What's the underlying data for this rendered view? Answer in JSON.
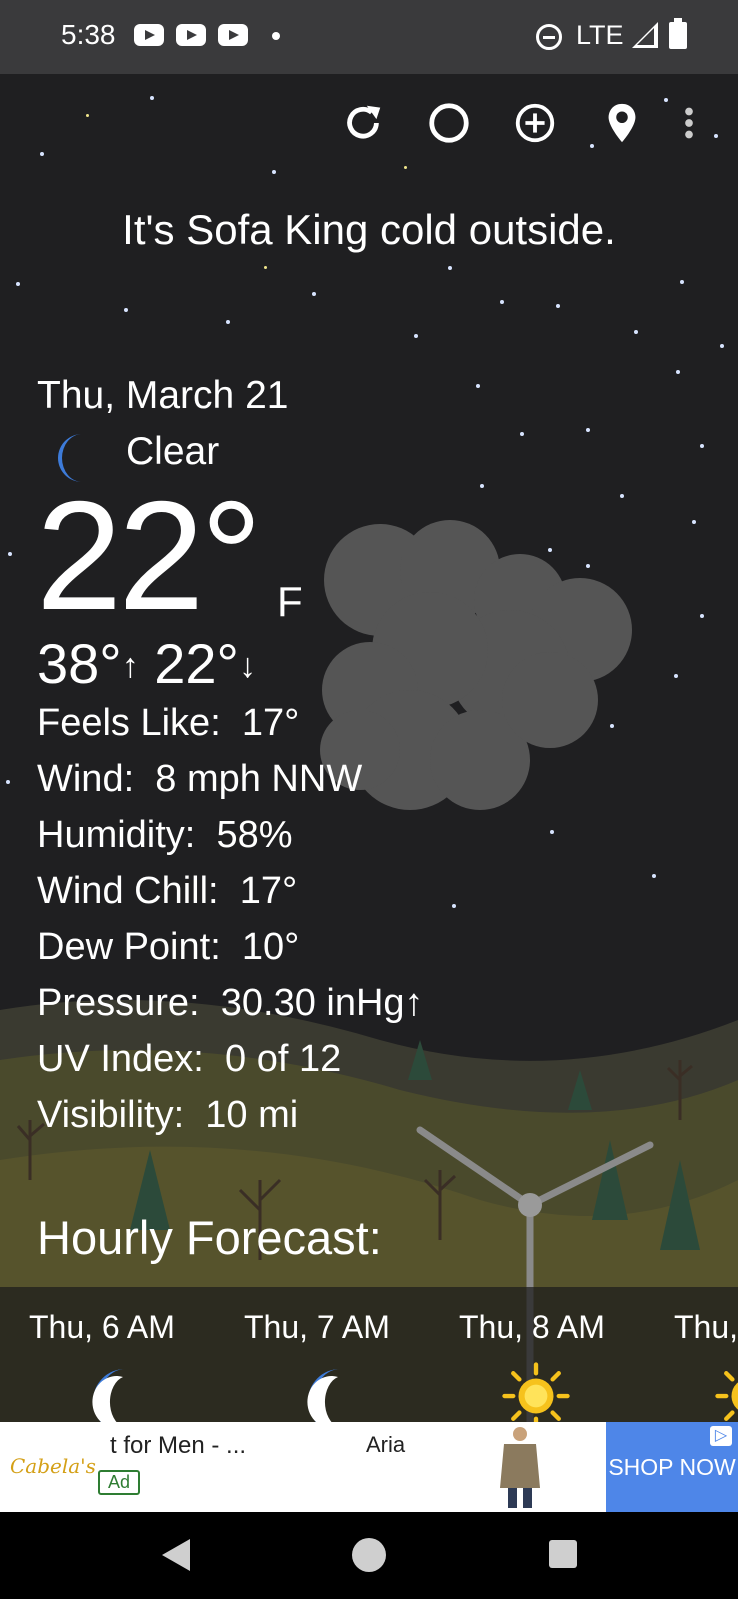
{
  "status_bar": {
    "time": "5:38",
    "network": "LTE"
  },
  "toolbar": {
    "refresh_icon": "refresh-icon",
    "theme_icon": "moon-phase-icon",
    "add_icon": "add-location-icon",
    "location_icon": "location-pin-icon",
    "menu_icon": "overflow-menu-icon"
  },
  "tagline": "It's Sofa King cold outside.",
  "current": {
    "date": "Thu, March 21",
    "condition": "Clear",
    "condition_icon": "moon-icon",
    "temperature": "22°",
    "unit": "F",
    "high": "38°",
    "low": "22°"
  },
  "details": [
    {
      "label": "Feels Like:",
      "value": "17°"
    },
    {
      "label": "Wind:",
      "value": "8 mph NNW"
    },
    {
      "label": "Humidity:",
      "value": "58%"
    },
    {
      "label": "Wind Chill:",
      "value": "17°"
    },
    {
      "label": "Dew Point:",
      "value": "10°"
    },
    {
      "label": "Pressure:",
      "value": "30.30 inHg↑"
    },
    {
      "label": "UV Index:",
      "value": "0 of 12"
    },
    {
      "label": "Visibility:",
      "value": "10 mi"
    }
  ],
  "hourly": {
    "title": "Hourly Forecast:",
    "items": [
      {
        "label": "Thu, 6 AM",
        "icon": "moon-icon"
      },
      {
        "label": "Thu, 7 AM",
        "icon": "moon-icon"
      },
      {
        "label": "Thu, 8 AM",
        "icon": "sun-icon"
      },
      {
        "label": "Thu,",
        "icon": "sun-icon"
      }
    ]
  },
  "ad": {
    "brand": "Cabela's",
    "headline": "t for Men - ...",
    "label": "Ad",
    "subtext": "Aria",
    "cta": "SHOP NOW"
  },
  "colors": {
    "background": "#1f1f21",
    "status_bar": "#3a3a3c",
    "moon": "#3d7bd9",
    "sun": "#f6c21c",
    "ad_cta": "#4e86e8"
  }
}
